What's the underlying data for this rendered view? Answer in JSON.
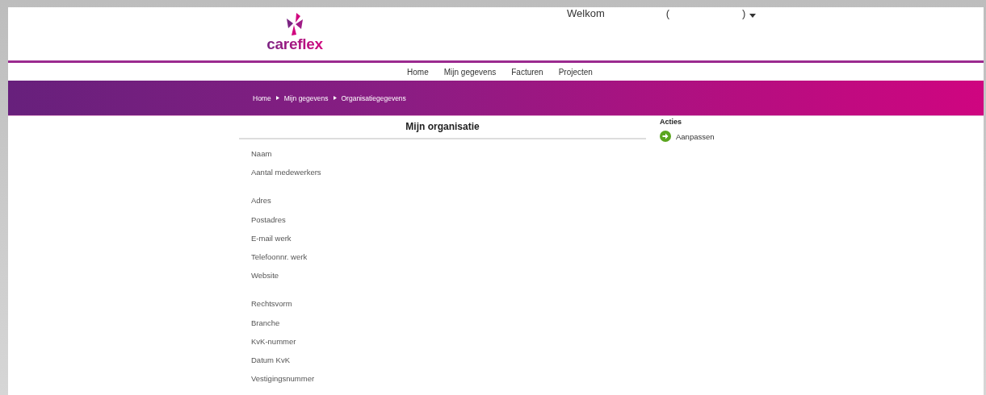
{
  "header": {
    "logo_text": "careflex",
    "welcome": "Welkom",
    "paren_open": "(",
    "paren_close": ")"
  },
  "nav": [
    {
      "label": "Home"
    },
    {
      "label": "Mijn gegevens"
    },
    {
      "label": "Facturen"
    },
    {
      "label": "Projecten"
    }
  ],
  "breadcrumb": [
    "Home",
    "Mijn gegevens",
    "Organisatiegegevens"
  ],
  "main": {
    "title": "Mijn organisatie",
    "sections": [
      {
        "fields": [
          "Naam",
          "Aantal medewerkers"
        ]
      },
      {
        "fields": [
          "Adres",
          "Postadres",
          "E-mail werk",
          "Telefoonnr. werk",
          "Website"
        ]
      },
      {
        "fields": [
          "Rechtsvorm",
          "Branche",
          "KvK-nummer",
          "Datum KvK",
          "Vestigingsnummer"
        ]
      }
    ]
  },
  "actions": {
    "title": "Acties",
    "items": [
      {
        "label": "Aanpassen"
      }
    ]
  }
}
